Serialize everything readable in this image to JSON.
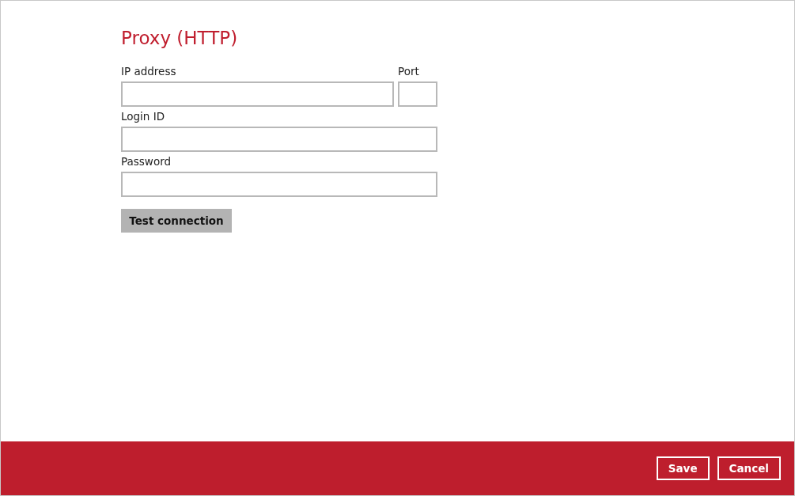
{
  "title": "Proxy (HTTP)",
  "fields": [
    {
      "label": "IP address",
      "kind": "wide"
    },
    {
      "label": "Port",
      "kind": "narrow"
    },
    {
      "label": "Login ID",
      "kind": "full"
    },
    {
      "label": "Password",
      "kind": "full"
    }
  ],
  "test_button": "Test connection",
  "footer_buttons": [
    "Save",
    "Cancel"
  ]
}
